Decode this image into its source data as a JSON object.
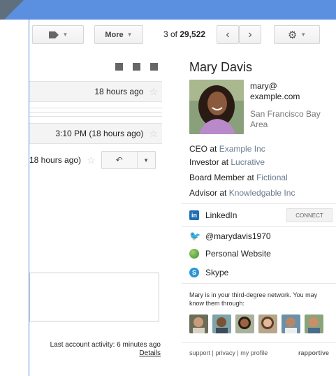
{
  "toolbar": {
    "more_label": "More",
    "counter_prefix": "3 of",
    "counter_total": "29,522",
    "icons": [
      "label-icon",
      "chevron-left-icon",
      "chevron-right-icon",
      "gear-icon"
    ]
  },
  "colors": {
    "topbar": "#5b8fe0",
    "linkedin": "#1f6fb2",
    "twitter": "#2aa3ef",
    "skype": "#2a95d6"
  },
  "messages": {
    "row1_time": "18 hours ago",
    "row2_time": "3:10 PM (18 hours ago)",
    "row3_time": "18 hours ago)"
  },
  "activity": {
    "text": "Last account activity: 6 minutes ago",
    "details_label": "Details"
  },
  "profile": {
    "name": "Mary Davis",
    "email_line1": "mary@",
    "email_line2": "example.com",
    "location_line1": "San Francisco Bay",
    "location_line2": "Area",
    "roles": [
      {
        "title": "CEO at",
        "org": "Example Inc"
      },
      {
        "title": "Investor at",
        "org": "Lucrative"
      },
      {
        "title": "Board Member at",
        "org": "Fictional"
      },
      {
        "title": "Advisor at",
        "org": "Knowledgable Inc"
      }
    ],
    "social": [
      {
        "label": "LinkedIn",
        "icon": "linkedin-icon"
      },
      {
        "label": "@marydavis1970",
        "icon": "twitter-icon"
      },
      {
        "label": "Personal Website",
        "icon": "globe-icon"
      },
      {
        "label": "Skype",
        "icon": "skype-icon"
      }
    ],
    "connect_label": "CONNECT",
    "network_note": "Mary is in your third-degree network. You may know them through:",
    "footer_links": "support | privacy | my profile",
    "footer_brand": "rapportive"
  }
}
